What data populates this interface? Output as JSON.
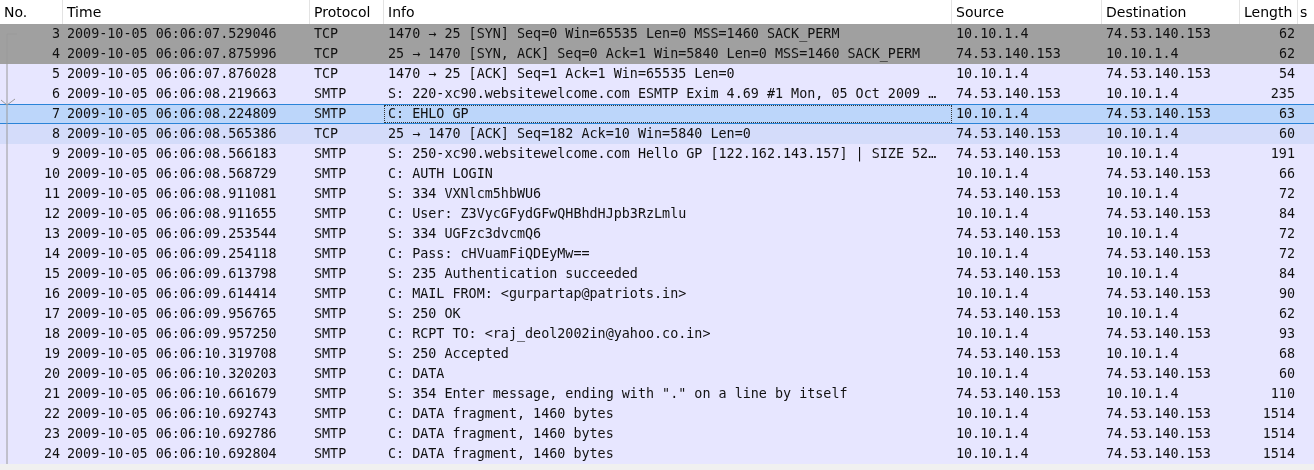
{
  "packet_list": {
    "columns": [
      "No.",
      "Time",
      "Protocol",
      "Info",
      "Source",
      "Destination",
      "Length",
      "s"
    ],
    "rows": [
      {
        "no": "3",
        "time": "2009-10-05 06:06:07.529046",
        "protocol": "TCP",
        "info": "1470 → 25 [SYN] Seq=0 Win=65535 Len=0 MSS=1460 SACK_PERM",
        "source": "10.10.1.4",
        "destination": "74.53.140.153",
        "length": "62",
        "color": "#a0a0a0",
        "selected": false
      },
      {
        "no": "4",
        "time": "2009-10-05 06:06:07.875996",
        "protocol": "TCP",
        "info": "25 → 1470 [SYN, ACK] Seq=0 Ack=1 Win=5840 Len=0 MSS=1460 SACK_PERM",
        "source": "74.53.140.153",
        "destination": "10.10.1.4",
        "length": "62",
        "color": "#a0a0a0",
        "selected": false
      },
      {
        "no": "5",
        "time": "2009-10-05 06:06:07.876028",
        "protocol": "TCP",
        "info": "1470 → 25 [ACK] Seq=1 Ack=1 Win=65535 Len=0",
        "source": "10.10.1.4",
        "destination": "74.53.140.153",
        "length": "54",
        "color": "#e7e6ff",
        "selected": false
      },
      {
        "no": "6",
        "time": "2009-10-05 06:06:08.219663",
        "protocol": "SMTP",
        "info": "S: 220-xc90.websitewelcome.com ESMTP Exim 4.69 #1 Mon, 05 Oct 2009 …",
        "source": "74.53.140.153",
        "destination": "10.10.1.4",
        "length": "235",
        "color": "#e7e6ff",
        "selected": false
      },
      {
        "no": "7",
        "time": "2009-10-05 06:06:08.224809",
        "protocol": "SMTP",
        "info": "C: EHLO GP",
        "source": "10.10.1.4",
        "destination": "74.53.140.153",
        "length": "63",
        "selected": true
      },
      {
        "no": "8",
        "time": "2009-10-05 06:06:08.565386",
        "protocol": "TCP",
        "info": "25 → 1470 [ACK] Seq=182 Ack=10 Win=5840 Len=0",
        "source": "74.53.140.153",
        "destination": "10.10.1.4",
        "length": "60",
        "color": "#d4dcfa",
        "selected": false
      },
      {
        "no": "9",
        "time": "2009-10-05 06:06:08.566183",
        "protocol": "SMTP",
        "info": "S: 250-xc90.websitewelcome.com Hello GP [122.162.143.157] | SIZE 52…",
        "source": "74.53.140.153",
        "destination": "10.10.1.4",
        "length": "191",
        "color": "#e7e6ff",
        "selected": false
      },
      {
        "no": "10",
        "time": "2009-10-05 06:06:08.568729",
        "protocol": "SMTP",
        "info": "C: AUTH LOGIN",
        "source": "10.10.1.4",
        "destination": "74.53.140.153",
        "length": "66",
        "color": "#e7e6ff",
        "selected": false
      },
      {
        "no": "11",
        "time": "2009-10-05 06:06:08.911081",
        "protocol": "SMTP",
        "info": "S: 334 VXNlcm5hbWU6",
        "source": "74.53.140.153",
        "destination": "10.10.1.4",
        "length": "72",
        "color": "#e7e6ff",
        "selected": false
      },
      {
        "no": "12",
        "time": "2009-10-05 06:06:08.911655",
        "protocol": "SMTP",
        "info": "C: User: Z3VycGFydGFwQHBhdHJpb3RzLmlu",
        "source": "10.10.1.4",
        "destination": "74.53.140.153",
        "length": "84",
        "color": "#e7e6ff",
        "selected": false
      },
      {
        "no": "13",
        "time": "2009-10-05 06:06:09.253544",
        "protocol": "SMTP",
        "info": "S: 334 UGFzc3dvcmQ6",
        "source": "74.53.140.153",
        "destination": "10.10.1.4",
        "length": "72",
        "color": "#e7e6ff",
        "selected": false
      },
      {
        "no": "14",
        "time": "2009-10-05 06:06:09.254118",
        "protocol": "SMTP",
        "info": "C: Pass: cHVuamFiQDEyMw==",
        "source": "10.10.1.4",
        "destination": "74.53.140.153",
        "length": "72",
        "color": "#e7e6ff",
        "selected": false
      },
      {
        "no": "15",
        "time": "2009-10-05 06:06:09.613798",
        "protocol": "SMTP",
        "info": "S: 235 Authentication succeeded",
        "source": "74.53.140.153",
        "destination": "10.10.1.4",
        "length": "84",
        "color": "#e7e6ff",
        "selected": false
      },
      {
        "no": "16",
        "time": "2009-10-05 06:06:09.614414",
        "protocol": "SMTP",
        "info": "C: MAIL FROM: <gurpartap@patriots.in>",
        "source": "10.10.1.4",
        "destination": "74.53.140.153",
        "length": "90",
        "color": "#e7e6ff",
        "selected": false
      },
      {
        "no": "17",
        "time": "2009-10-05 06:06:09.956765",
        "protocol": "SMTP",
        "info": "S: 250 OK",
        "source": "74.53.140.153",
        "destination": "10.10.1.4",
        "length": "62",
        "color": "#e7e6ff",
        "selected": false
      },
      {
        "no": "18",
        "time": "2009-10-05 06:06:09.957250",
        "protocol": "SMTP",
        "info": "C: RCPT TO: <raj_deol2002in@yahoo.co.in>",
        "source": "10.10.1.4",
        "destination": "74.53.140.153",
        "length": "93",
        "color": "#e7e6ff",
        "selected": false
      },
      {
        "no": "19",
        "time": "2009-10-05 06:06:10.319708",
        "protocol": "SMTP",
        "info": "S: 250 Accepted",
        "source": "74.53.140.153",
        "destination": "10.10.1.4",
        "length": "68",
        "color": "#e7e6ff",
        "selected": false
      },
      {
        "no": "20",
        "time": "2009-10-05 06:06:10.320203",
        "protocol": "SMTP",
        "info": "C: DATA",
        "source": "10.10.1.4",
        "destination": "74.53.140.153",
        "length": "60",
        "color": "#e7e6ff",
        "selected": false
      },
      {
        "no": "21",
        "time": "2009-10-05 06:06:10.661679",
        "protocol": "SMTP",
        "info": "S: 354 Enter message, ending with \".\" on a line by itself",
        "source": "74.53.140.153",
        "destination": "10.10.1.4",
        "length": "110",
        "color": "#e7e6ff",
        "selected": false
      },
      {
        "no": "22",
        "time": "2009-10-05 06:06:10.692743",
        "protocol": "SMTP",
        "info": "C: DATA fragment, 1460 bytes",
        "source": "10.10.1.4",
        "destination": "74.53.140.153",
        "length": "1514",
        "color": "#e7e6ff",
        "selected": false
      },
      {
        "no": "23",
        "time": "2009-10-05 06:06:10.692786",
        "protocol": "SMTP",
        "info": "C: DATA fragment, 1460 bytes",
        "source": "10.10.1.4",
        "destination": "74.53.140.153",
        "length": "1514",
        "color": "#e7e6ff",
        "selected": false
      },
      {
        "no": "24",
        "time": "2009-10-05 06:06:10.692804",
        "protocol": "SMTP",
        "info": "C: DATA fragment, 1460 bytes",
        "source": "10.10.1.4",
        "destination": "74.53.140.153",
        "length": "1514",
        "color": "#e7e6ff",
        "selected": false
      }
    ]
  }
}
